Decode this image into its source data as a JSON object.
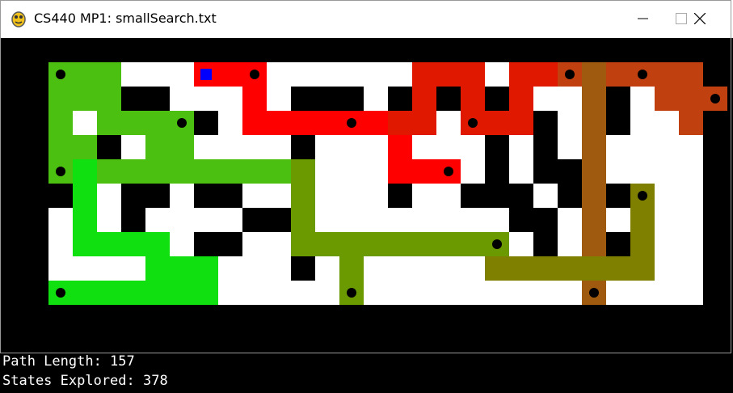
{
  "window": {
    "title": "CS440 MP1: smallSearch.txt"
  },
  "status": {
    "path_length": "Path Length: 157",
    "states_explored": "States Explored: 378"
  },
  "colors": {
    "wall": "#000000",
    "floor": "#ffffff",
    "agent": "#0000ff",
    "goal": "#000000"
  },
  "icons": {
    "app": "pygame-snake-icon",
    "minimize": "minimize-icon",
    "maximize": "maximize-icon",
    "close": "close-icon"
  },
  "maze": {
    "cols": 29,
    "rows": 13,
    "grid": [
      "#############################",
      "#.....  .....  .   .   .... #",
      "#   ## . #.###.# # #   ## . #",
      "#.. ##.# #    .#    ##  #.. #",
      "#  # ## .. #.. #.. # #  .. .#",
      "#...   ..  #.. .  .# ## ..  #",
      "##  ## ##  #   #  ### # #.. #",
      "#.  #.  .##    .   .## #    #",
      "#.. ## ##   ## #. ## # ## ..#",
      "#         .#.  .  .  .  ... #",
      "#.....   ...  .  ..   .  ...#",
      "#############################",
      "#############################"
    ],
    "agent": [
      7,
      1
    ],
    "goals": [
      [
        1,
        1
      ],
      [
        9,
        1
      ],
      [
        22,
        1
      ],
      [
        25,
        1
      ],
      [
        28,
        2
      ],
      [
        6,
        3
      ],
      [
        13,
        3
      ],
      [
        18,
        3
      ],
      [
        1,
        5
      ],
      [
        17,
        5
      ],
      [
        25,
        6
      ],
      [
        19,
        8
      ],
      [
        1,
        10
      ],
      [
        13,
        10
      ],
      [
        23,
        10
      ]
    ],
    "path_segments": [
      {
        "color": "#ff0000",
        "cells": [
          [
            7,
            1
          ],
          [
            8,
            1
          ],
          [
            9,
            1
          ],
          [
            9,
            2
          ],
          [
            9,
            3
          ],
          [
            10,
            3
          ],
          [
            11,
            3
          ],
          [
            12,
            3
          ],
          [
            13,
            3
          ],
          [
            14,
            3
          ],
          [
            15,
            3
          ],
          [
            15,
            4
          ],
          [
            15,
            5
          ],
          [
            16,
            5
          ],
          [
            17,
            5
          ]
        ]
      },
      {
        "color": "#e01800",
        "cells": [
          [
            15,
            3
          ],
          [
            16,
            3
          ],
          [
            16,
            2
          ],
          [
            16,
            1
          ],
          [
            17,
            1
          ],
          [
            18,
            1
          ],
          [
            18,
            2
          ],
          [
            18,
            3
          ],
          [
            19,
            3
          ],
          [
            20,
            3
          ],
          [
            20,
            2
          ],
          [
            20,
            1
          ],
          [
            21,
            1
          ],
          [
            22,
            1
          ]
        ]
      },
      {
        "color": "#c04010",
        "cells": [
          [
            22,
            1
          ],
          [
            23,
            1
          ],
          [
            24,
            1
          ],
          [
            25,
            1
          ],
          [
            26,
            1
          ],
          [
            27,
            1
          ],
          [
            27,
            2
          ],
          [
            28,
            2
          ],
          [
            27,
            3
          ],
          [
            26,
            2
          ]
        ]
      },
      {
        "color": "#a05a10",
        "cells": [
          [
            23,
            1
          ],
          [
            23,
            2
          ],
          [
            23,
            3
          ],
          [
            23,
            4
          ],
          [
            23,
            5
          ],
          [
            23,
            6
          ],
          [
            23,
            7
          ],
          [
            23,
            8
          ],
          [
            23,
            9
          ],
          [
            23,
            10
          ]
        ]
      },
      {
        "color": "#808000",
        "cells": [
          [
            19,
            8
          ],
          [
            19,
            9
          ],
          [
            20,
            9
          ],
          [
            21,
            9
          ],
          [
            22,
            9
          ],
          [
            23,
            9
          ],
          [
            24,
            9
          ],
          [
            25,
            9
          ],
          [
            25,
            8
          ],
          [
            25,
            7
          ],
          [
            25,
            6
          ]
        ]
      },
      {
        "color": "#6a9a00",
        "cells": [
          [
            11,
            5
          ],
          [
            11,
            6
          ],
          [
            11,
            7
          ],
          [
            11,
            8
          ],
          [
            12,
            8
          ],
          [
            13,
            8
          ],
          [
            14,
            8
          ],
          [
            15,
            8
          ],
          [
            16,
            8
          ],
          [
            17,
            8
          ],
          [
            18,
            8
          ],
          [
            19,
            8
          ],
          [
            13,
            8
          ],
          [
            13,
            9
          ],
          [
            13,
            10
          ]
        ]
      },
      {
        "color": "#4cc010",
        "cells": [
          [
            5,
            5
          ],
          [
            5,
            4
          ],
          [
            6,
            4
          ],
          [
            6,
            3
          ],
          [
            5,
            3
          ],
          [
            4,
            3
          ],
          [
            3,
            3
          ],
          [
            3,
            2
          ],
          [
            3,
            1
          ],
          [
            2,
            1
          ],
          [
            1,
            1
          ],
          [
            1,
            2
          ],
          [
            2,
            2
          ],
          [
            1,
            3
          ],
          [
            1,
            4
          ],
          [
            2,
            4
          ],
          [
            2,
            5
          ],
          [
            1,
            5
          ],
          [
            3,
            5
          ],
          [
            4,
            5
          ],
          [
            6,
            5
          ],
          [
            7,
            5
          ],
          [
            8,
            5
          ],
          [
            9,
            5
          ],
          [
            10,
            5
          ]
        ]
      },
      {
        "color": "#10e010",
        "cells": [
          [
            2,
            5
          ],
          [
            2,
            6
          ],
          [
            2,
            7
          ],
          [
            2,
            8
          ],
          [
            3,
            8
          ],
          [
            4,
            8
          ],
          [
            5,
            8
          ],
          [
            5,
            9
          ],
          [
            6,
            9
          ],
          [
            7,
            9
          ],
          [
            7,
            10
          ],
          [
            6,
            10
          ],
          [
            5,
            10
          ],
          [
            4,
            10
          ],
          [
            3,
            10
          ],
          [
            2,
            10
          ],
          [
            1,
            10
          ]
        ]
      }
    ]
  }
}
